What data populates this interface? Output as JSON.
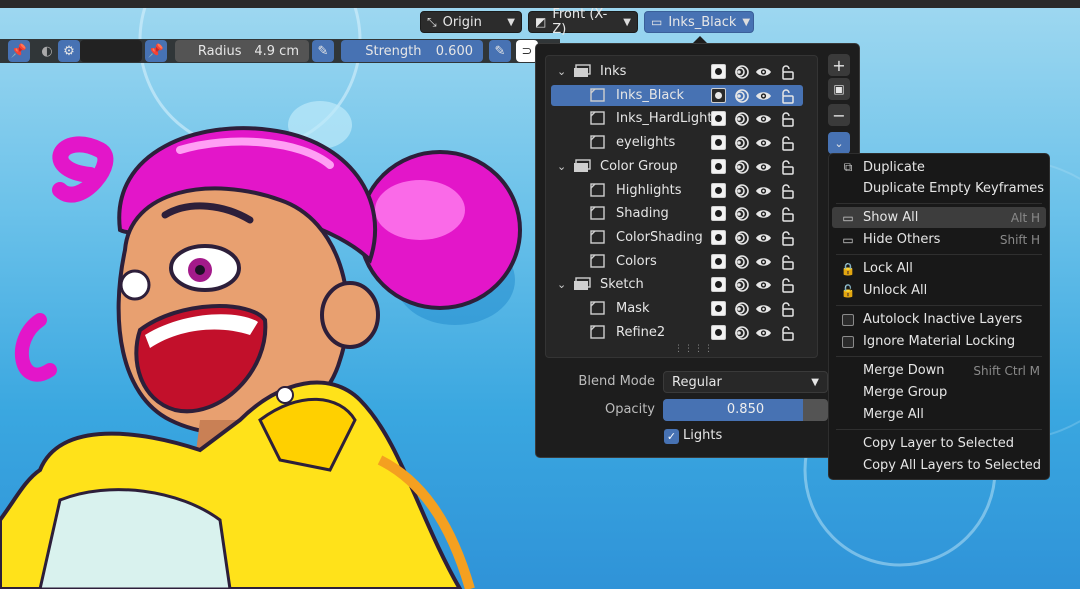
{
  "header": {
    "pivot_label": "Origin",
    "view_label": "Front (X-Z)",
    "active_layer_label": "Inks_Black"
  },
  "tool": {
    "radius_label": "Radius",
    "radius_value": "4.9 cm",
    "strength_label": "Strength",
    "strength_value": "0.600"
  },
  "layers": {
    "rows": [
      {
        "name": "Inks",
        "group": true,
        "expanded": true
      },
      {
        "name": "Inks_Black",
        "group": false,
        "selected": true
      },
      {
        "name": "Inks_HardLight",
        "group": false
      },
      {
        "name": "eyelights",
        "group": false
      },
      {
        "name": "Color Group",
        "group": true,
        "expanded": true
      },
      {
        "name": "Highlights",
        "group": false
      },
      {
        "name": "Shading",
        "group": false
      },
      {
        "name": "ColorShading",
        "group": false
      },
      {
        "name": "Colors",
        "group": false
      },
      {
        "name": "Sketch",
        "group": true,
        "expanded": true
      },
      {
        "name": "Mask",
        "group": false
      },
      {
        "name": "Refine2",
        "group": false
      }
    ]
  },
  "properties": {
    "blend_mode_label": "Blend Mode",
    "blend_mode_value": "Regular",
    "opacity_label": "Opacity",
    "opacity_value": "0.850",
    "opacity_fraction": 0.85,
    "lights_label": "Lights",
    "lights_checked": true
  },
  "menu": {
    "duplicate": "Duplicate",
    "duplicate_empty": "Duplicate Empty Keyframes",
    "show_all": "Show All",
    "show_all_shortcut": "Alt H",
    "hide_others": "Hide Others",
    "hide_others_shortcut": "Shift H",
    "lock_all": "Lock All",
    "unlock_all": "Unlock All",
    "autolock": "Autolock Inactive Layers",
    "ignore_material": "Ignore Material Locking",
    "merge_down": "Merge Down",
    "merge_down_shortcut": "Shift Ctrl M",
    "merge_group": "Merge Group",
    "merge_all": "Merge All",
    "copy_layer": "Copy Layer to Selected",
    "copy_all": "Copy All Layers to Selected"
  },
  "colors": {
    "accent": "#4772b3",
    "panel": "#1d1d1d",
    "sky": "#3aa7e0"
  }
}
